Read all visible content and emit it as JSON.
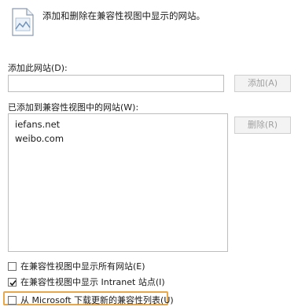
{
  "header": {
    "description": "添加和删除在兼容性视图中显示的网站。",
    "icon": "compatibility-view-icon"
  },
  "add_section": {
    "label": "添加此网站(D):",
    "input_value": "",
    "add_button": "添加(A)"
  },
  "list_section": {
    "label": "已添加到兼容性视图中的网站(W):",
    "sites": [
      "iefans.net",
      "weibo.com"
    ],
    "remove_button": "删除(R)"
  },
  "options": [
    {
      "label": "在兼容性视图中显示所有网站(E)",
      "checked": false
    },
    {
      "label": "在兼容性视图中显示 Intranet 站点(I)",
      "checked": true
    },
    {
      "label": "从 Microsoft 下载更新的兼容性列表(U)",
      "checked": false
    }
  ],
  "colors": {
    "highlight": "#e8a74a",
    "border": "#bdbdbd",
    "disabled_text": "#a0a0a0"
  }
}
